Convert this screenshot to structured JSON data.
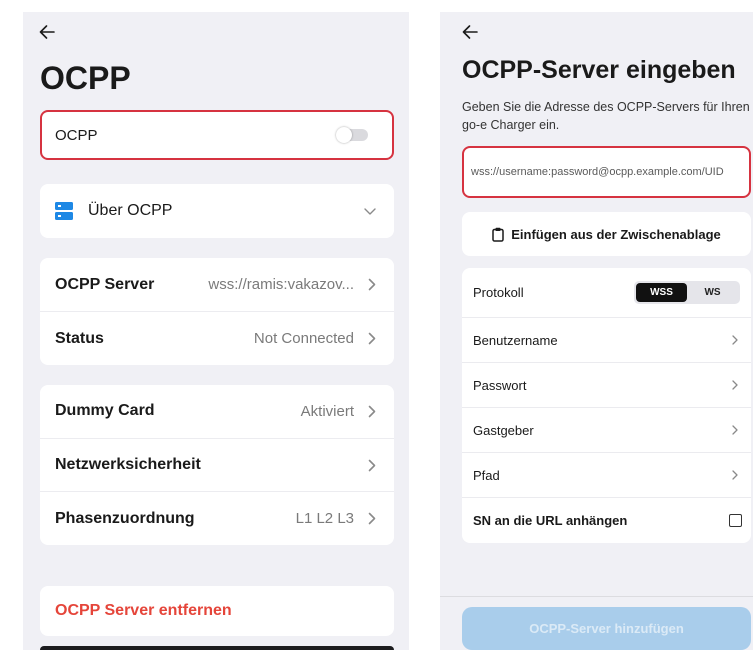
{
  "left_screen": {
    "title": "OCPP",
    "toggle_card": {
      "label": "OCPP",
      "enabled": false
    },
    "about": {
      "label": "Über OCPP"
    },
    "server_group": [
      {
        "label": "OCPP Server",
        "value": "wss://ramis:vakazov..."
      },
      {
        "label": "Status",
        "value": "Not Connected"
      }
    ],
    "settings_group": [
      {
        "label": "Dummy Card",
        "value": "Aktiviert"
      },
      {
        "label": "Netzwerksicherheit"
      },
      {
        "label": "Phasenzuordnung",
        "value": "L1 L2 L3"
      }
    ],
    "remove_label": "OCPP Server entfernen"
  },
  "right_screen": {
    "title": "OCPP-Server eingeben",
    "description": "Geben Sie die Adresse des OCPP-Servers für Ihren go-e Charger ein.",
    "url_input": {
      "value": "",
      "placeholder": "wss://username:password@ocpp.example.com/UID"
    },
    "paste_label": "Einfügen aus der Zwischenablage",
    "protocol": {
      "label": "Protokoll",
      "options": [
        "WSS",
        "WS"
      ],
      "selected_index": 0
    },
    "rows": [
      {
        "label": "Benutzername"
      },
      {
        "label": "Passwort"
      },
      {
        "label": "Gastgeber"
      },
      {
        "label": "Pfad"
      }
    ],
    "append_sn": {
      "label": "SN an die URL anhängen",
      "checked": false
    },
    "submit_label": "OCPP-Server hinzufügen",
    "submit_enabled": false
  },
  "icons": {
    "back": "arrow-left-icon",
    "about": "server-icon",
    "expand": "chevron-down-icon",
    "navigate": "chevron-right-icon",
    "paste": "clipboard-icon"
  },
  "colors": {
    "screen_bg": "#f0f0f5",
    "card_bg": "#ffffff",
    "highlight": "#d63340",
    "danger_text": "#e5453a",
    "icon_blue": "#1e88e5",
    "primary_disabled": "#a9cdeb",
    "text_primary": "#1a1a1a",
    "text_secondary": "#7a7a7a"
  }
}
